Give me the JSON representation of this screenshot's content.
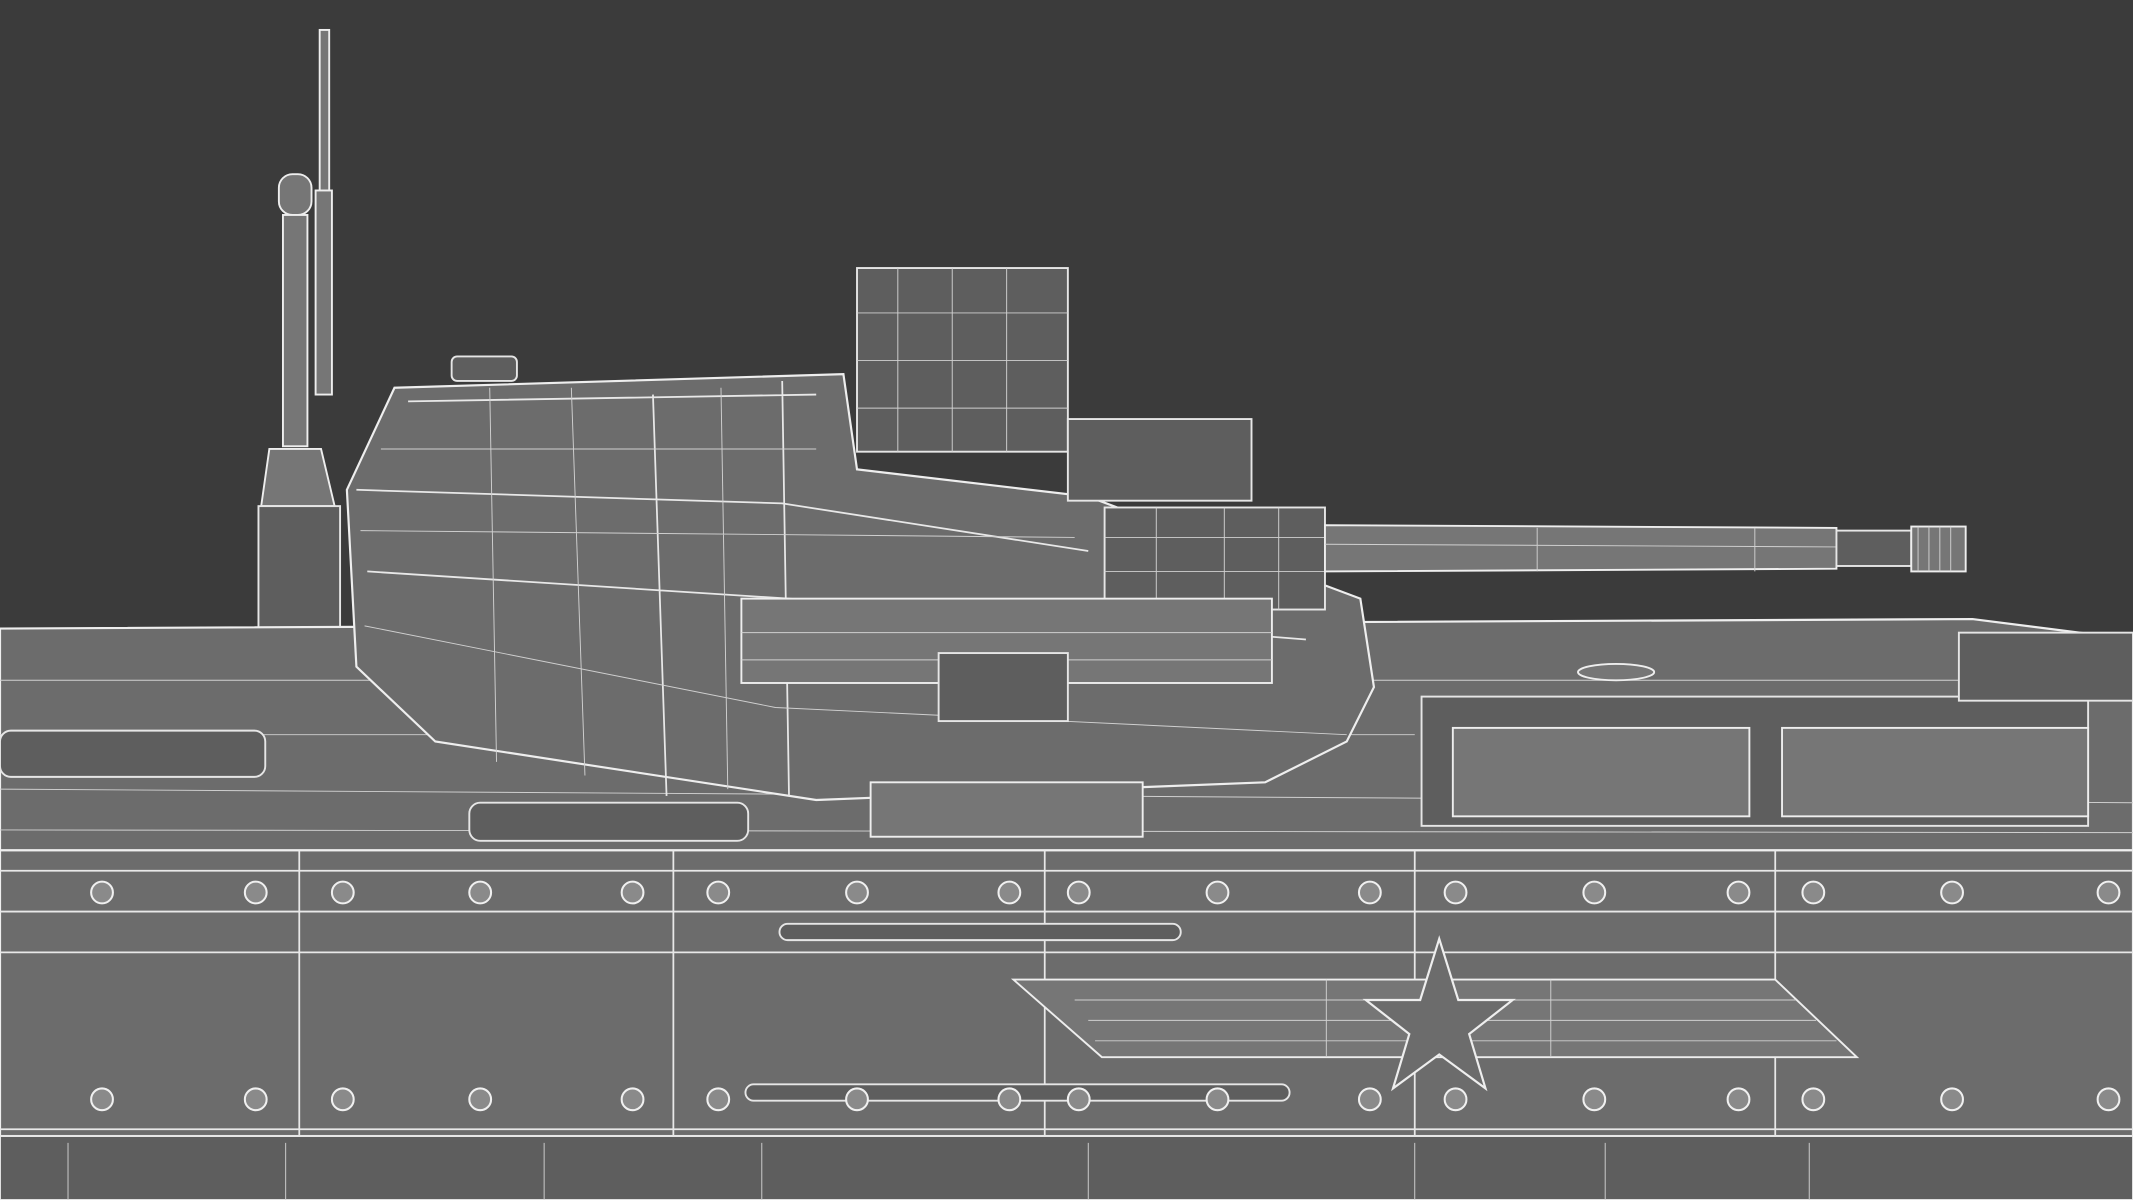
{
  "scene": {
    "subject": "tank-wireframe-render",
    "colors": {
      "background": "#3b3b3b",
      "surface": "#6c6c6c",
      "wire": "#e8e8e8"
    }
  }
}
